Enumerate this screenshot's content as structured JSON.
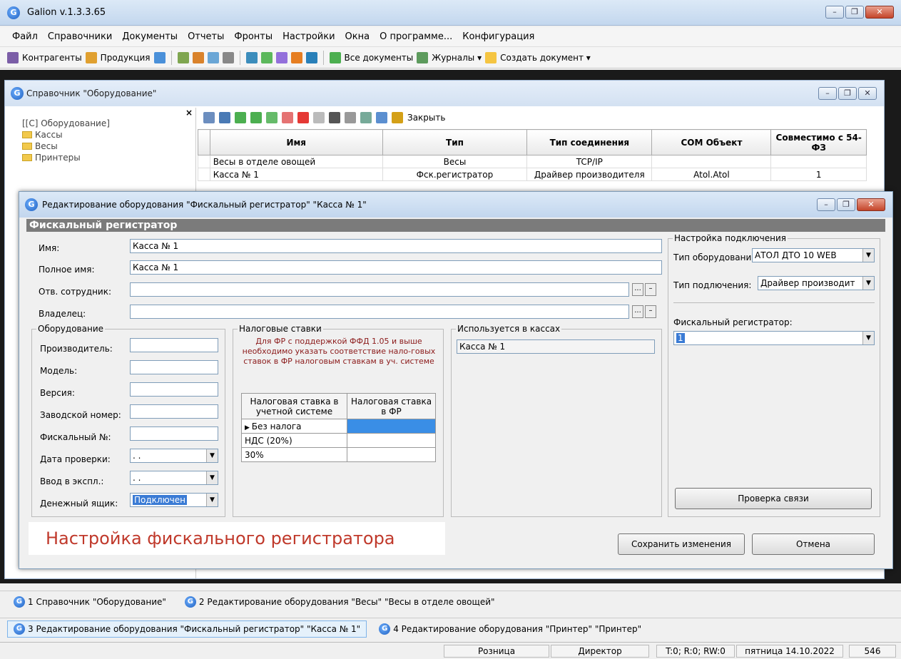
{
  "app": {
    "title": "Galion v.1.3.3.65"
  },
  "menu": [
    "Файл",
    "Справочники",
    "Документы",
    "Отчеты",
    "Фронты",
    "Настройки",
    "Окна",
    "О программе...",
    "Конфигурация"
  ],
  "toolbar": {
    "contractors": "Контрагенты",
    "products": "Продукция",
    "all_docs": "Все документы",
    "journals": "Журналы ▾",
    "create_doc": "Создать документ ▾"
  },
  "ref": {
    "title": "Справочник \"Оборудование\"",
    "tree": [
      "[[C] Оборудование]",
      "Кассы",
      "Весы",
      "Принтеры"
    ],
    "close": "Закрыть",
    "cols": [
      "Имя",
      "Тип",
      "Тип соединения",
      "COM Объект",
      "Совместимо с 54-ФЗ"
    ],
    "rows": [
      [
        "Весы в отделе овощей",
        "Весы",
        "TCP/IP",
        "",
        ""
      ],
      [
        "Касса № 1",
        "Фск.регистратор",
        "Драйвер производителя",
        "Atol.Atol",
        "1"
      ]
    ]
  },
  "dlg": {
    "title": "Редактирование оборудования \"Фискальный регистратор\" \"Касса № 1\"",
    "section": "Фискальный регистратор",
    "name_label": "Имя:",
    "name": "Касса № 1",
    "fullname_label": "Полное имя:",
    "fullname": "Касса № 1",
    "employee_label": "Отв. сотрудник:",
    "owner_label": "Владелец:",
    "dots": "...",
    "minus": "–",
    "equip": {
      "title": "Оборудование",
      "manufacturer": "Производитель:",
      "model": "Модель:",
      "version": "Версия:",
      "serial": "Заводской номер:",
      "fiscal": "Фискальный №:",
      "check_date": "Дата проверки:",
      "commission": "Ввод в экспл.:",
      "cash_drawer": "Денежный ящик:",
      "drawer_value": "Подключен",
      "date_blank": ". ."
    },
    "tax": {
      "title": "Налоговые ставки",
      "note": "Для ФР с поддержкой ФФД 1.05 и выше необходимо указать соответствие нало-говых ставок в ФР налоговым ставкам в уч. системе",
      "col1": "Налоговая ставка в учетной системе",
      "col2": "Налоговая ставка в ФР",
      "rows": [
        "Без налога",
        "НДС (20%)",
        "30%"
      ]
    },
    "used": {
      "title": "Используется в кассах",
      "value": "Касса № 1"
    },
    "conn": {
      "title": "Настройка подключения",
      "equip_type_label": "Тип оборудования:",
      "equip_type": "АТОЛ ДТО 10 WEB",
      "conn_type_label": "Тип подлючения:",
      "conn_type": "Драйвер производит",
      "fr_label": "Фискальный регистратор:",
      "fr_value": "1",
      "check": "Проверка связи"
    },
    "caption": "Настройка фискального регистратора",
    "save": "Сохранить изменения",
    "cancel": "Отмена"
  },
  "tasks": [
    "1 Справочник \"Оборудование\"",
    "2 Редактирование оборудования \"Весы\" \"Весы в отделе овощей\"",
    "3 Редактирование оборудования \"Фискальный регистратор\" \"Касса № 1\"",
    "4 Редактирование оборудования \"Принтер\" \"Принтер\""
  ],
  "status": {
    "mode": "Розница",
    "role": "Директор",
    "counters": "T:0; R:0; RW:0",
    "date": "пятница 14.10.2022",
    "num": "546"
  },
  "colors": {
    "caption": "#c0392b",
    "tax_note": "#8b1a1a",
    "selected": "#3a7bd5"
  }
}
